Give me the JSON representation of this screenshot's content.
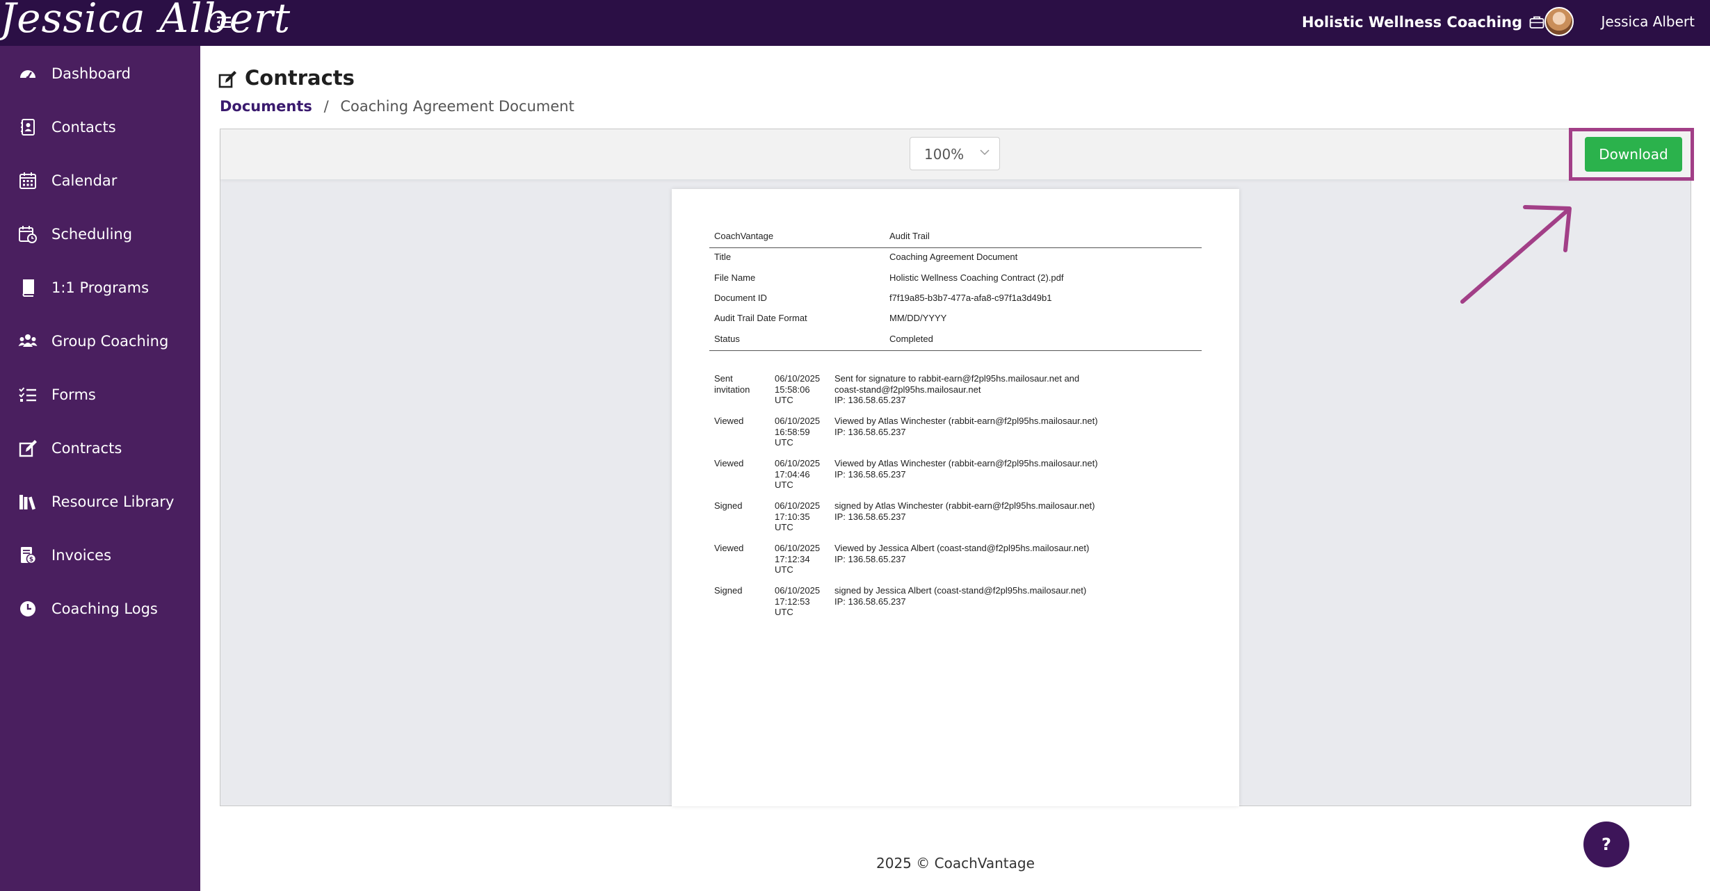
{
  "header": {
    "brand": "Jessica Albert",
    "company": "Holistic Wellness Coaching",
    "user_name": "Jessica Albert"
  },
  "sidebar": {
    "items": [
      {
        "label": "Dashboard",
        "icon": "dashboard-icon"
      },
      {
        "label": "Contacts",
        "icon": "contacts-icon"
      },
      {
        "label": "Calendar",
        "icon": "calendar-icon"
      },
      {
        "label": "Scheduling",
        "icon": "scheduling-icon"
      },
      {
        "label": "1:1 Programs",
        "icon": "book-icon"
      },
      {
        "label": "Group Coaching",
        "icon": "group-icon"
      },
      {
        "label": "Forms",
        "icon": "forms-icon"
      },
      {
        "label": "Contracts",
        "icon": "contracts-icon"
      },
      {
        "label": "Resource Library",
        "icon": "library-icon"
      },
      {
        "label": "Invoices",
        "icon": "invoice-icon"
      },
      {
        "label": "Coaching Logs",
        "icon": "clock-icon"
      }
    ]
  },
  "page": {
    "title": "Contracts",
    "breadcrumb": {
      "link": "Documents",
      "separator": "/",
      "current": "Coaching Agreement Document"
    }
  },
  "viewer": {
    "zoom": "100%",
    "download_label": "Download"
  },
  "document": {
    "header_left": "CoachVantage",
    "header_right": "Audit Trail",
    "fields": [
      {
        "label": "Title",
        "value": "Coaching Agreement Document"
      },
      {
        "label": "File Name",
        "value": "Holistic Wellness Coaching Contract (2).pdf"
      },
      {
        "label": "Document ID",
        "value": "f7f19a85-b3b7-477a-afa8-c97f1a3d49b1"
      },
      {
        "label": "Audit Trail Date Format",
        "value": "MM/DD/YYYY"
      },
      {
        "label": "Status",
        "value": "Completed"
      }
    ],
    "events": [
      {
        "type": [
          "Sent",
          "invitation"
        ],
        "when": [
          "06/10/2025",
          "15:58:06",
          "UTC"
        ],
        "detail": [
          "Sent for signature to rabbit-earn@f2pl95hs.mailosaur.net and",
          "coast-stand@f2pl95hs.mailosaur.net",
          "IP: 136.58.65.237"
        ]
      },
      {
        "type": [
          "Viewed"
        ],
        "when": [
          "06/10/2025",
          "16:58:59",
          "UTC"
        ],
        "detail": [
          "Viewed by Atlas Winchester (rabbit-earn@f2pl95hs.mailosaur.net)",
          "IP: 136.58.65.237"
        ]
      },
      {
        "type": [
          "Viewed"
        ],
        "when": [
          "06/10/2025",
          "17:04:46",
          "UTC"
        ],
        "detail": [
          "Viewed by Atlas Winchester (rabbit-earn@f2pl95hs.mailosaur.net)",
          "IP: 136.58.65.237"
        ]
      },
      {
        "type": [
          "Signed"
        ],
        "when": [
          "06/10/2025",
          "17:10:35",
          "UTC"
        ],
        "detail": [
          "signed by Atlas Winchester (rabbit-earn@f2pl95hs.mailosaur.net)",
          "IP: 136.58.65.237"
        ]
      },
      {
        "type": [
          "Viewed"
        ],
        "when": [
          "06/10/2025",
          "17:12:34",
          "UTC"
        ],
        "detail": [
          "Viewed by Jessica Albert (coast-stand@f2pl95hs.mailosaur.net)",
          "IP: 136.58.65.237"
        ]
      },
      {
        "type": [
          "Signed"
        ],
        "when": [
          "06/10/2025",
          "17:12:53",
          "UTC"
        ],
        "detail": [
          "signed by Jessica Albert (coast-stand@f2pl95hs.mailosaur.net)",
          "IP: 136.58.65.237"
        ]
      }
    ]
  },
  "footer": {
    "text": "2025 © CoachVantage"
  },
  "help": {
    "label": "?"
  },
  "colors": {
    "topbar": "#2b0f45",
    "sidebar": "#4a1f5f",
    "download": "#2bb24c",
    "highlight": "#a23f87"
  }
}
